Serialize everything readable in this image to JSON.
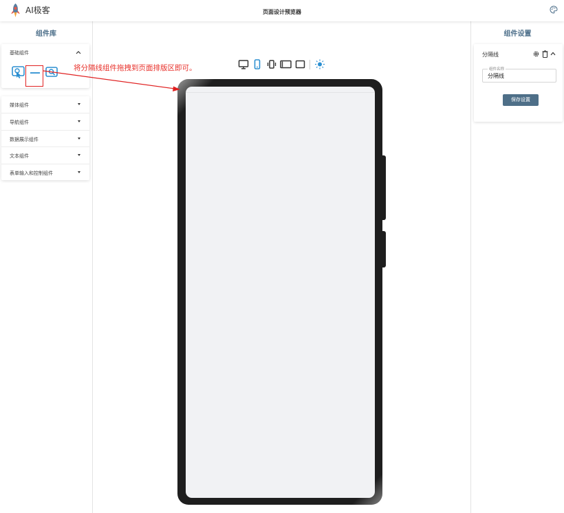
{
  "header": {
    "app_title": "AI极客",
    "center_title": "页面设计预览器"
  },
  "left_panel": {
    "title": "组件库",
    "basic_category": {
      "label": "基础组件",
      "expanded": true
    },
    "categories": [
      {
        "label": "媒体组件"
      },
      {
        "label": "导航组件"
      },
      {
        "label": "数据展示组件"
      },
      {
        "label": "文本组件"
      },
      {
        "label": "表单输入和控制组件"
      }
    ]
  },
  "annotation": {
    "text": "将分隔线组件拖拽到页面排版区即可。",
    "color": "#e8302a"
  },
  "device_toolbar": {
    "icons": [
      "desktop-icon",
      "mobile-icon",
      "vibrate-icon",
      "tablet-landscape-icon",
      "tablet-icon",
      "theme-sun-icon"
    ],
    "selected": "mobile-icon"
  },
  "right_panel": {
    "title": "组件设置",
    "component_name": "分隔线",
    "field": {
      "label": "组件名称",
      "value": "分隔线"
    },
    "save_label": "保存设置"
  },
  "colors": {
    "accent": "#4e6f88",
    "panel_title": "#4d6f8a",
    "icon_blue": "#2b8fd1",
    "annotation_red": "#e8302a"
  }
}
